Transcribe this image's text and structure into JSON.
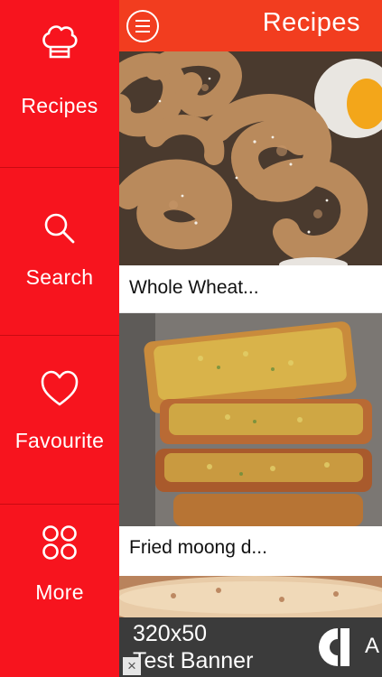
{
  "sidebar": {
    "items": [
      {
        "label": "Recipes",
        "icon": "chef-hat-icon"
      },
      {
        "label": "Search",
        "icon": "search-icon"
      },
      {
        "label": "Favourite",
        "icon": "heart-icon"
      },
      {
        "label": "More",
        "icon": "grid-circles-icon"
      }
    ]
  },
  "header": {
    "title": "Recipes",
    "menu_icon": "hamburger-menu-icon"
  },
  "recipes": [
    {
      "title": "Whole Wheat..."
    },
    {
      "title": "Fried moong d..."
    }
  ],
  "ad": {
    "line1": "320x50",
    "line2": "Test Banner",
    "letter": "A",
    "close": "×"
  },
  "colors": {
    "sidebar": "#f7141e",
    "header": "#f23d1f",
    "caption_bg": "#ffffff",
    "ad_bg": "#3b3b3b"
  }
}
